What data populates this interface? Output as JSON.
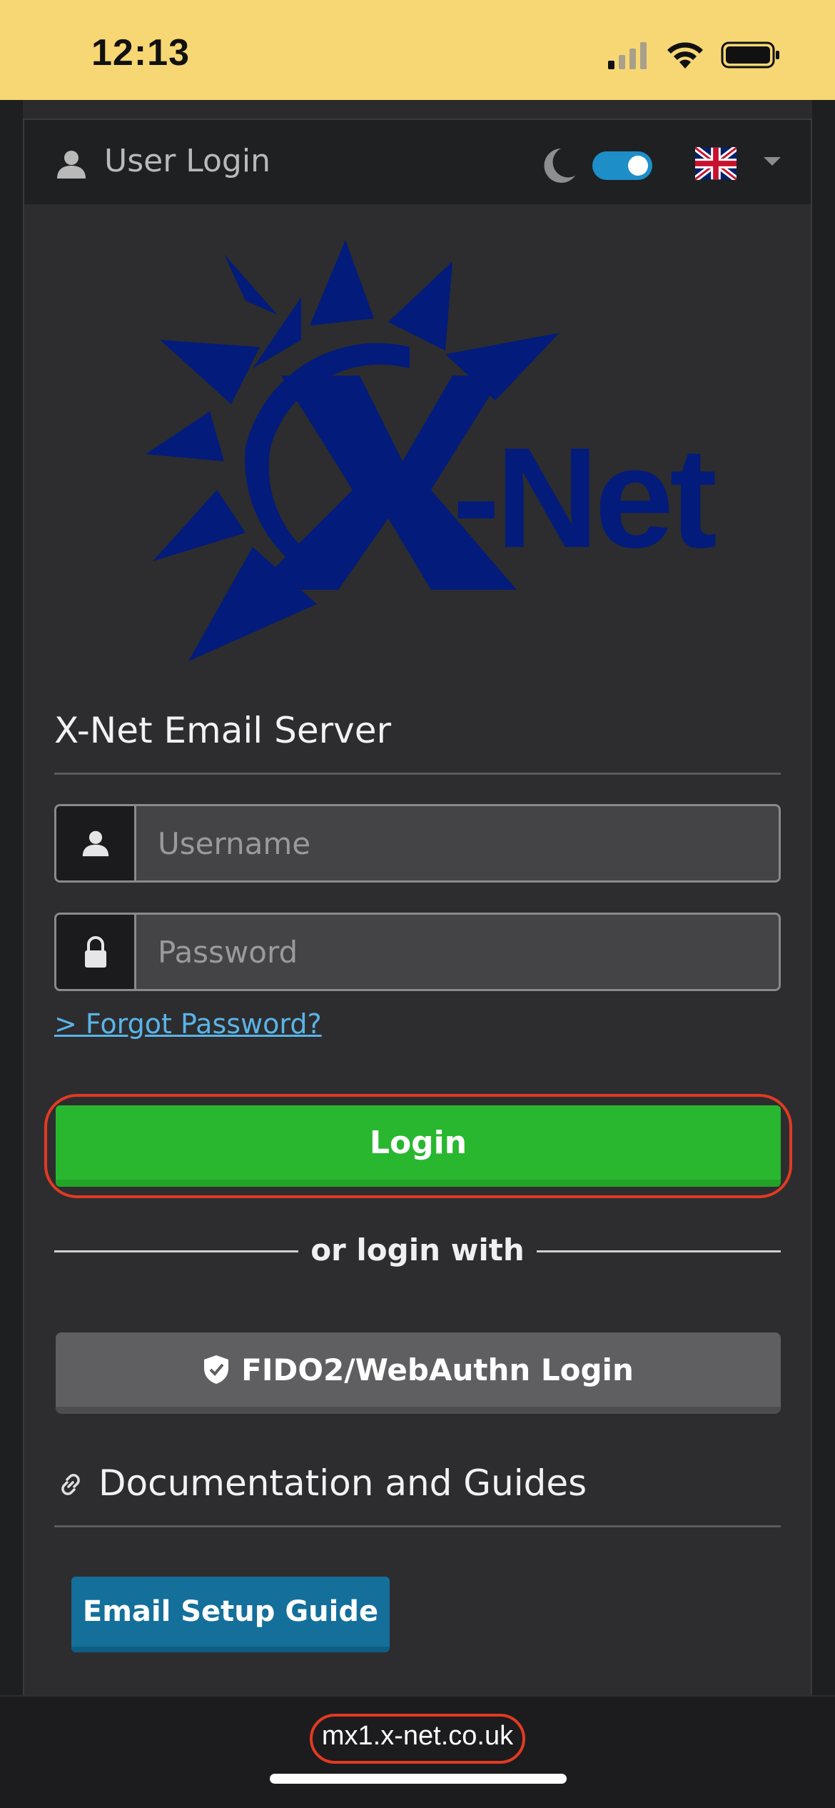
{
  "status_bar": {
    "time": "12:13"
  },
  "header": {
    "title": "User Login",
    "dark_mode_enabled": true,
    "language_flag": "uk-flag"
  },
  "logo": {
    "text": "X-Net",
    "color": "#031b7a"
  },
  "form": {
    "server_title": "X-Net Email Server",
    "username_placeholder": "Username",
    "password_placeholder": "Password",
    "forgot_password": "> Forgot Password?",
    "login_button": "Login",
    "or_login_with": "or login with",
    "fido_button": "FIDO2/WebAuthn Login"
  },
  "documentation": {
    "title": "Documentation and Guides",
    "setup_guide_button": "Email Setup Guide"
  },
  "browser": {
    "url": "mx1.x-net.co.uk"
  },
  "colors": {
    "status_bar_bg": "#f7d774",
    "login_green": "#29b72f",
    "toggle_blue": "#1e8ec9",
    "setup_blue": "#146f9a",
    "highlight_red": "#e23a22",
    "link_blue": "#5ab4e8"
  }
}
